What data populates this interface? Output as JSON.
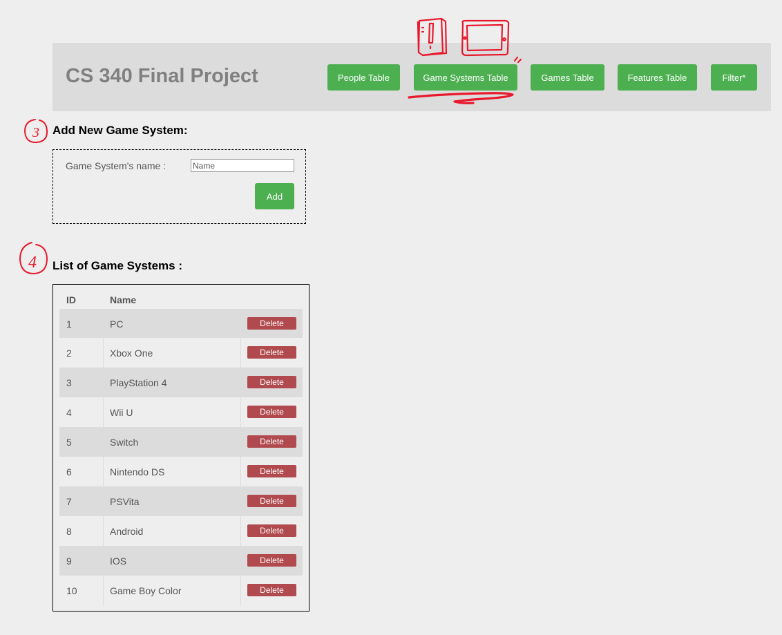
{
  "header": {
    "title": "CS 340 Final Project",
    "nav": [
      {
        "label": "People Table"
      },
      {
        "label": "Game Systems Table"
      },
      {
        "label": "Games Table"
      },
      {
        "label": "Features Table"
      },
      {
        "label": "Filter*"
      }
    ],
    "active_nav": "Game Systems Table"
  },
  "annotations": {
    "step_add": "3",
    "step_list": "4"
  },
  "add_form": {
    "heading": "Add New Game System:",
    "name_label": "Game System's name :",
    "name_placeholder": "Name",
    "add_label": "Add"
  },
  "list": {
    "heading": "List of Game Systems :",
    "columns": [
      "ID",
      "Name"
    ],
    "delete_label": "Delete",
    "rows": [
      {
        "id": "1",
        "name": "PC"
      },
      {
        "id": "2",
        "name": "Xbox One"
      },
      {
        "id": "3",
        "name": "PlayStation 4"
      },
      {
        "id": "4",
        "name": "Wii U"
      },
      {
        "id": "5",
        "name": "Switch"
      },
      {
        "id": "6",
        "name": "Nintendo DS"
      },
      {
        "id": "7",
        "name": "PSVita"
      },
      {
        "id": "8",
        "name": "Android"
      },
      {
        "id": "9",
        "name": "IOS"
      },
      {
        "id": "10",
        "name": "Game Boy Color"
      }
    ]
  },
  "colors": {
    "button_green": "#4caf50",
    "delete_red": "#b04a4e",
    "header_bg": "#dcdcdc",
    "page_bg": "#eeeeee",
    "annotation_red": "#e8192c"
  }
}
